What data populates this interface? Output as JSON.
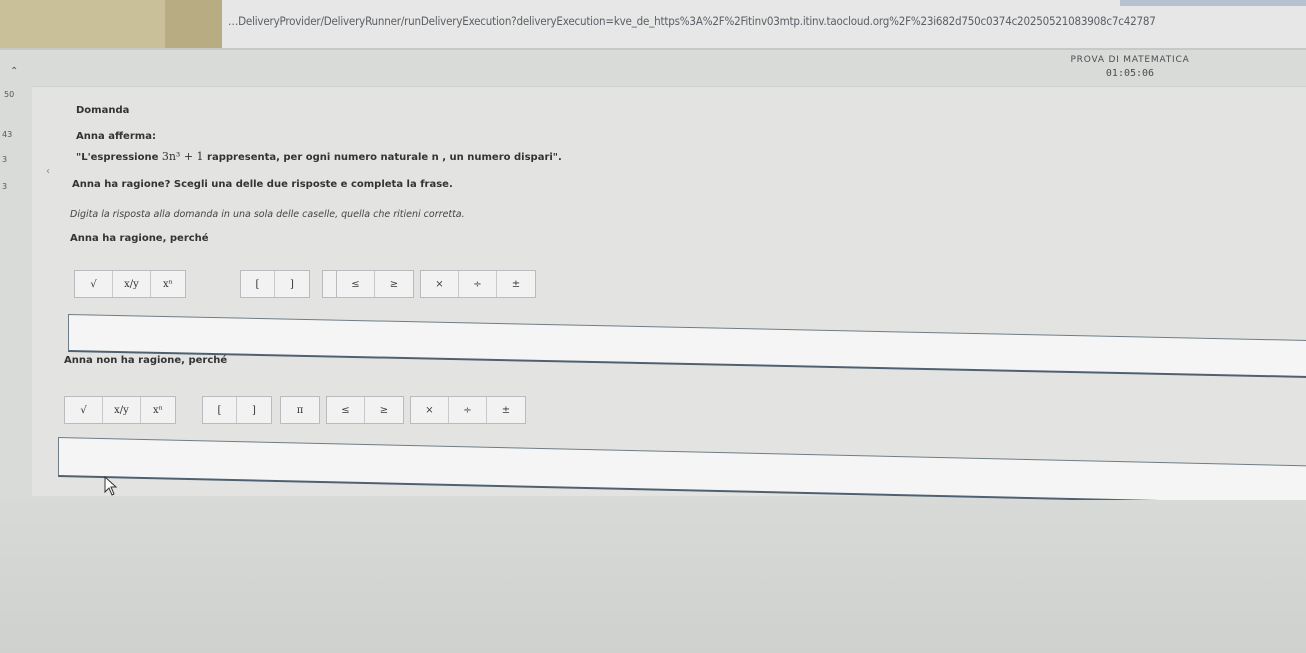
{
  "browser": {
    "url": "…DeliveryProvider/DeliveryRunner/runDeliveryExecution?deliveryExecution=kve_de_https%3A%2F%2Fitinv03mtp.itinv.taocloud.org%2F%23i682d750c0374c20250521083908c7c42787"
  },
  "header": {
    "test_title": "PROVA DI MATEMATICA",
    "timer": "01:05:06"
  },
  "sidebar": {
    "items": [
      "50",
      "43",
      "3",
      "3"
    ]
  },
  "question": {
    "heading": "Domanda",
    "line1": "Anna afferma:",
    "line2_prefix": "\"L'espressione",
    "line2_math": "3n³ + 1",
    "line2_suffix": "rappresenta, per ogni numero naturale n , un numero dispari\".",
    "line3": "Anna ha ragione? Scegli una delle due risposte e completa la frase.",
    "line4": "Digita la risposta alla domanda in una sola delle caselle, quella che ritieni corretta.",
    "option_a_label": "Anna ha ragione, perché",
    "option_b_label": "Anna non ha ragione, perché"
  },
  "toolbar": {
    "group1": [
      "√",
      "x/y",
      "xⁿ"
    ],
    "group2": [
      "[",
      "]"
    ],
    "group3": [
      "π"
    ],
    "group4": [
      "≤",
      "≥"
    ],
    "group5": [
      "×",
      "÷",
      "±"
    ]
  },
  "answers": {
    "a_value": "",
    "b_value": ""
  }
}
